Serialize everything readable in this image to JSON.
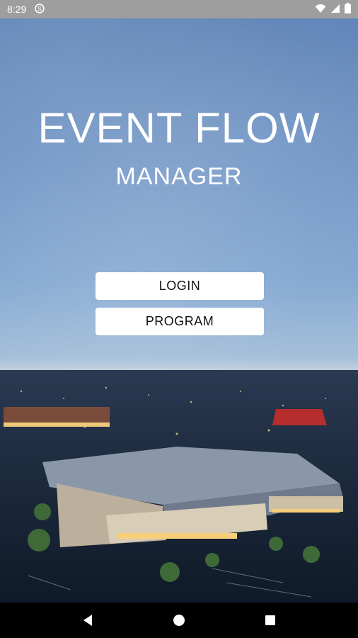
{
  "status_bar": {
    "time": "8:29",
    "icons": [
      "sim-card-icon",
      "wifi-icon",
      "signal-icon",
      "battery-icon"
    ]
  },
  "app": {
    "title": "EVENT FLOW",
    "subtitle": "MANAGER"
  },
  "buttons": {
    "login_label": "LOGIN",
    "program_label": "PROGRAM"
  },
  "nav": {
    "icons": [
      "back-icon",
      "home-icon",
      "recents-icon"
    ]
  },
  "colors": {
    "sky_top": "#5f84b7",
    "sky_bottom": "#a5bfd9",
    "button_bg": "#ffffff",
    "status_bar": "#9e9e9e",
    "nav_bar": "#000000"
  }
}
